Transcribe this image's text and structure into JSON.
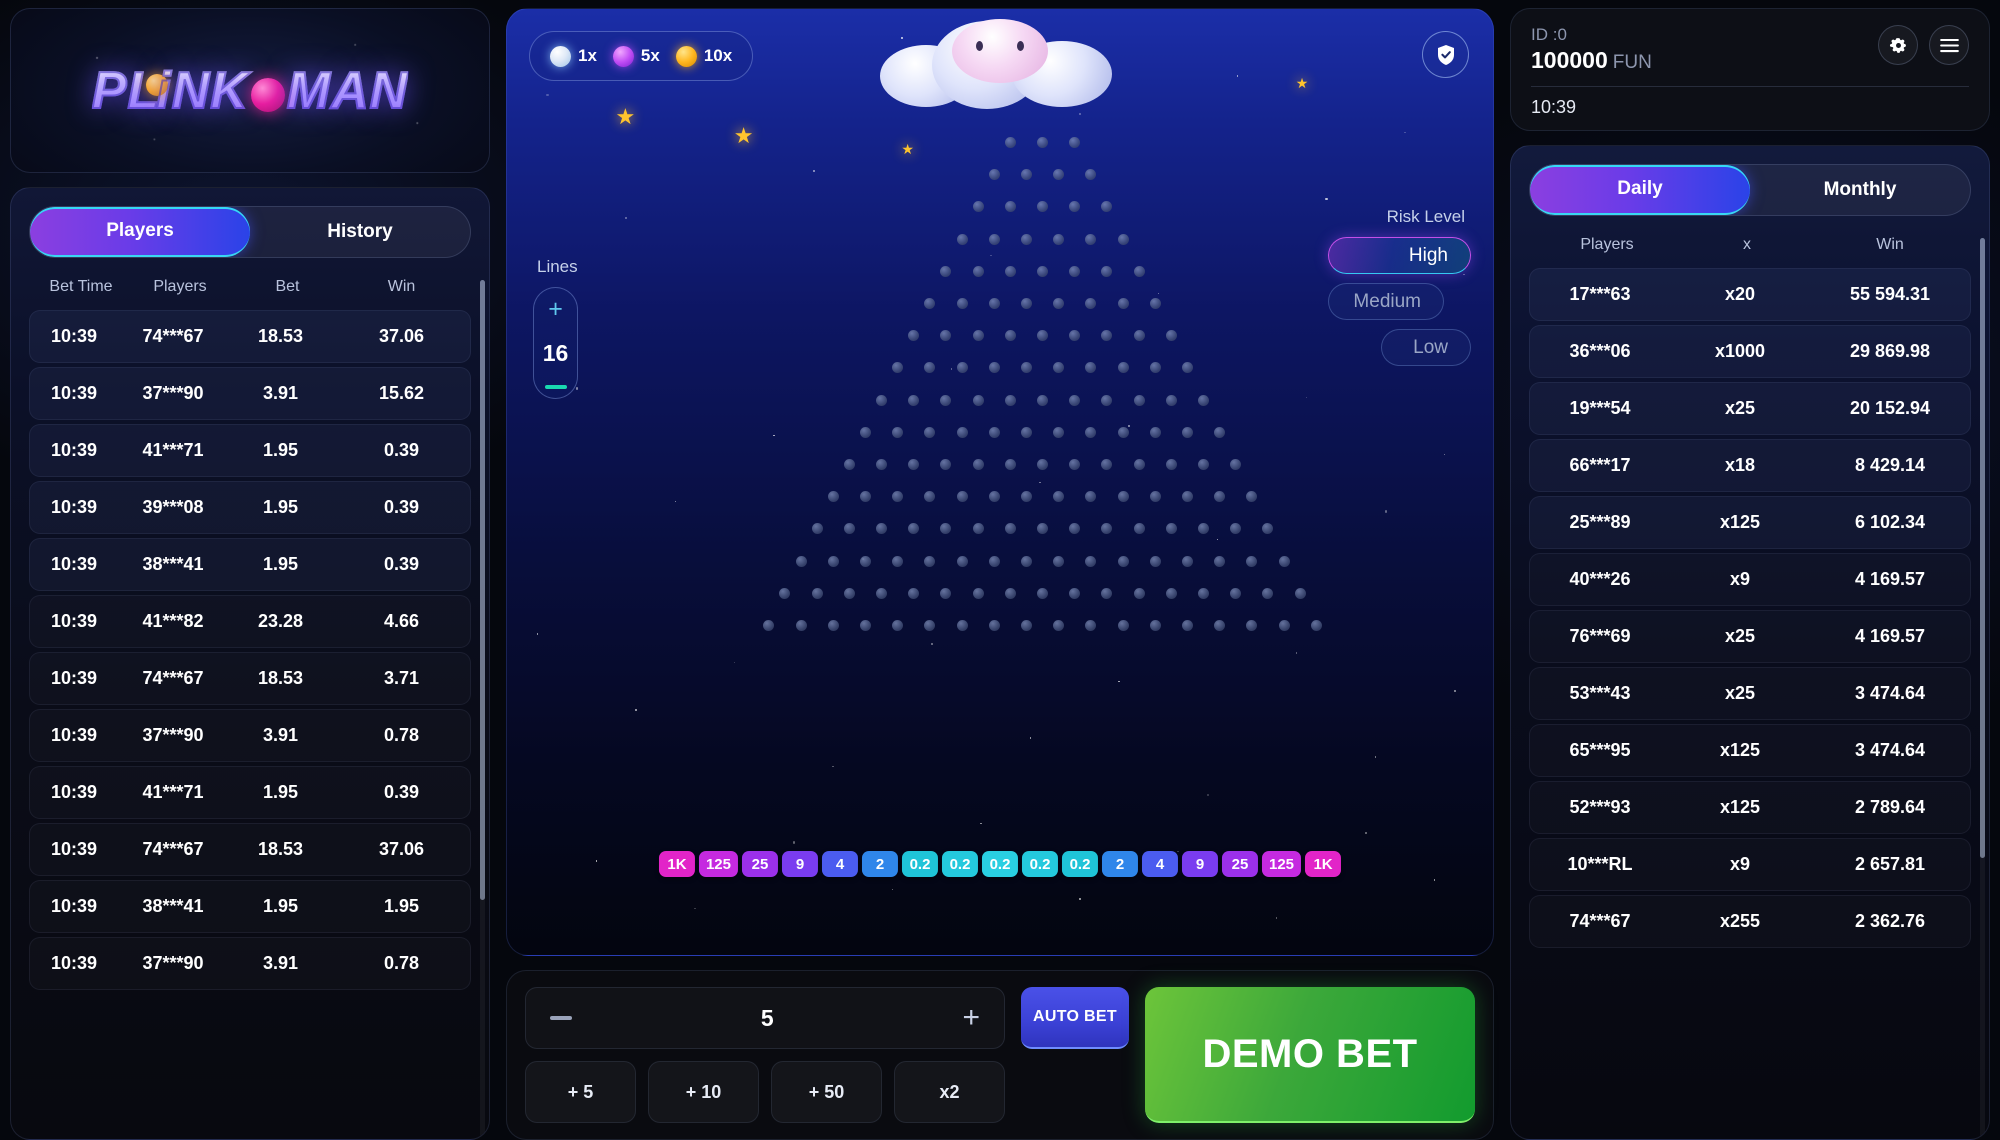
{
  "brand": {
    "name_part1": "PL",
    "name_part2": "NK",
    "name_part3": "MAN",
    "i_letter": "i"
  },
  "left_panel": {
    "tabs": [
      {
        "label": "Players",
        "active": true
      },
      {
        "label": "History",
        "active": false
      }
    ],
    "columns": [
      "Bet Time",
      "Players",
      "Bet",
      "Win"
    ],
    "rows": [
      {
        "time": "10:39",
        "player": "74***67",
        "bet": "18.53",
        "win": "37.06"
      },
      {
        "time": "10:39",
        "player": "37***90",
        "bet": "3.91",
        "win": "15.62"
      },
      {
        "time": "10:39",
        "player": "41***71",
        "bet": "1.95",
        "win": "0.39"
      },
      {
        "time": "10:39",
        "player": "39***08",
        "bet": "1.95",
        "win": "0.39"
      },
      {
        "time": "10:39",
        "player": "38***41",
        "bet": "1.95",
        "win": "0.39"
      },
      {
        "time": "10:39",
        "player": "41***82",
        "bet": "23.28",
        "win": "4.66"
      },
      {
        "time": "10:39",
        "player": "74***67",
        "bet": "18.53",
        "win": "3.71"
      },
      {
        "time": "10:39",
        "player": "37***90",
        "bet": "3.91",
        "win": "0.78"
      },
      {
        "time": "10:39",
        "player": "41***71",
        "bet": "1.95",
        "win": "0.39"
      },
      {
        "time": "10:39",
        "player": "74***67",
        "bet": "18.53",
        "win": "37.06"
      },
      {
        "time": "10:39",
        "player": "38***41",
        "bet": "1.95",
        "win": "1.95"
      },
      {
        "time": "10:39",
        "player": "37***90",
        "bet": "3.91",
        "win": "0.78"
      }
    ]
  },
  "board": {
    "ball_chips": [
      {
        "label": "1x",
        "color": "#cfe3f5"
      },
      {
        "label": "5x",
        "color": "#c24ef5"
      },
      {
        "label": "10x",
        "color": "#ffb71f"
      }
    ],
    "shield_icon": "shield-check-icon",
    "lines": {
      "label": "Lines",
      "value": "16",
      "plus_icon": "plus-icon",
      "minus_icon": "minus-icon"
    },
    "risk": {
      "label": "Risk Level",
      "options": [
        {
          "label": "High",
          "active": true
        },
        {
          "label": "Medium",
          "active": false
        },
        {
          "label": "Low",
          "active": false
        }
      ]
    },
    "multipliers": [
      {
        "label": "1K",
        "color": "#e224c8"
      },
      {
        "label": "125",
        "color": "#c52ae0"
      },
      {
        "label": "25",
        "color": "#9b30ea"
      },
      {
        "label": "9",
        "color": "#7a3cf0"
      },
      {
        "label": "4",
        "color": "#4b5cf0"
      },
      {
        "label": "2",
        "color": "#2f86ea"
      },
      {
        "label": "0.2",
        "color": "#1fc4d8"
      },
      {
        "label": "0.2",
        "color": "#24c9dd"
      },
      {
        "label": "0.2",
        "color": "#29cfe2"
      },
      {
        "label": "0.2",
        "color": "#24c9dd"
      },
      {
        "label": "0.2",
        "color": "#1fc4d8"
      },
      {
        "label": "2",
        "color": "#2f86ea"
      },
      {
        "label": "4",
        "color": "#4b5cf0"
      },
      {
        "label": "9",
        "color": "#7a3cf0"
      },
      {
        "label": "25",
        "color": "#9b30ea"
      },
      {
        "label": "125",
        "color": "#c52ae0"
      },
      {
        "label": "1K",
        "color": "#e224c8"
      }
    ]
  },
  "bet_panel": {
    "amount": "5",
    "minus_icon": "minus-icon",
    "plus_icon": "plus-icon",
    "quick_buttons": [
      "+ 5",
      "+ 10",
      "+ 50",
      "x2"
    ],
    "auto_bet": "AUTO BET",
    "demo_bet": "DEMO BET"
  },
  "account": {
    "id_label": "ID :0",
    "balance": "100000",
    "currency": "FUN",
    "time": "10:39",
    "gear_icon": "gear-icon",
    "menu_icon": "hamburger-menu-icon"
  },
  "leaderboard": {
    "tabs": [
      {
        "label": "Daily",
        "active": true
      },
      {
        "label": "Monthly",
        "active": false
      }
    ],
    "columns": [
      "Players",
      "x",
      "Win"
    ],
    "rows": [
      {
        "player": "17***63",
        "x": "x20",
        "win": "55 594.31"
      },
      {
        "player": "36***06",
        "x": "x1000",
        "win": "29 869.98"
      },
      {
        "player": "19***54",
        "x": "x25",
        "win": "20 152.94"
      },
      {
        "player": "66***17",
        "x": "x18",
        "win": "8 429.14"
      },
      {
        "player": "25***89",
        "x": "x125",
        "win": "6 102.34"
      },
      {
        "player": "40***26",
        "x": "x9",
        "win": "4 169.57"
      },
      {
        "player": "76***69",
        "x": "x25",
        "win": "4 169.57"
      },
      {
        "player": "53***43",
        "x": "x25",
        "win": "3 474.64"
      },
      {
        "player": "65***95",
        "x": "x125",
        "win": "3 474.64"
      },
      {
        "player": "52***93",
        "x": "x125",
        "win": "2 789.64"
      },
      {
        "player": "10***RL",
        "x": "x9",
        "win": "2 657.81"
      },
      {
        "player": "74***67",
        "x": "x255",
        "win": "2 362.76"
      }
    ]
  }
}
